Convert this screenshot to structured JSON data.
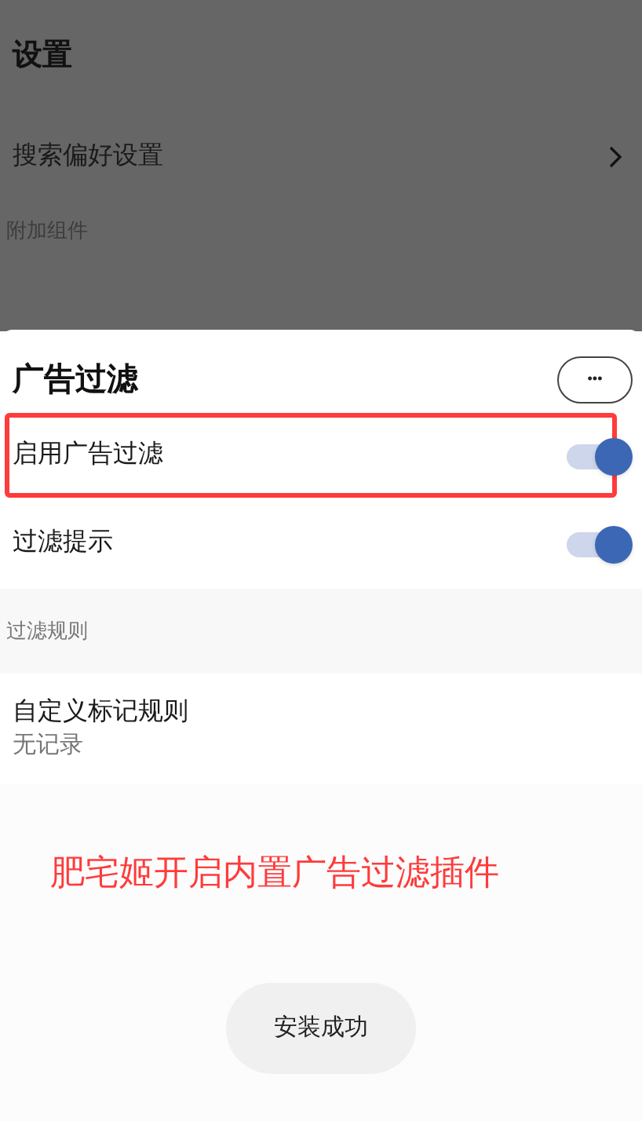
{
  "background": {
    "title": "设置",
    "items": [
      {
        "label": "搜索偏好设置"
      }
    ],
    "section": "附加组件"
  },
  "sheet": {
    "title": "广告过滤",
    "more_label": "•••",
    "switches": [
      {
        "label": "启用广告过滤",
        "on": true,
        "highlighted": true
      },
      {
        "label": "过滤提示",
        "on": true,
        "highlighted": false
      }
    ],
    "section": "过滤规则",
    "rules": [
      {
        "title": "自定义标记规则",
        "subtitle": "无记录"
      }
    ]
  },
  "annotation": "肥宅姬开启内置广告过滤插件",
  "toast": "安装成功"
}
